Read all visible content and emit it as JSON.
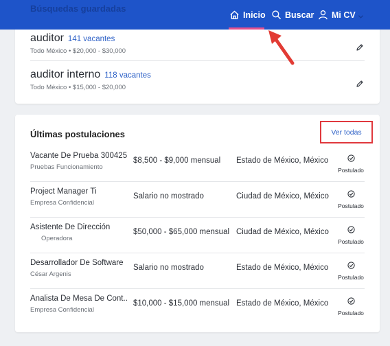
{
  "nav": {
    "background_title": "Búsquedas guardadas",
    "items": [
      {
        "label": "Inicio",
        "icon": "home-icon",
        "active": true
      },
      {
        "label": "Buscar",
        "icon": "search-icon"
      },
      {
        "label": "Mi CV",
        "icon": "user-icon"
      }
    ],
    "accent": "#e2508f",
    "bar_color": "#1e54c9"
  },
  "saved_searches": [
    {
      "query": "auditor",
      "count": "141 vacantes",
      "meta": "Todo México • $20,000 - $30,000"
    },
    {
      "query": "auditor interno",
      "count": "118 vacantes",
      "meta": "Todo México • $15,000 - $20,000"
    }
  ],
  "applications": {
    "title": "Últimas postulaciones",
    "see_all": "Ver todas",
    "rows": [
      {
        "title": "Vacante De Prueba 300425",
        "company": "Pruebas Funcionamiento",
        "salary": "$8,500 - $9,000 mensual",
        "location": "Estado de México, México",
        "status": "Postulado"
      },
      {
        "title": "Project Manager Ti",
        "company": "Empresa Confidencial",
        "salary": "Salario no mostrado",
        "location": "Ciudad de México, México",
        "status": "Postulado"
      },
      {
        "title": "Asistente De Dirección",
        "company": "Operadora",
        "salary": "$50,000 - $65,000 mensual",
        "location": "Ciudad de México, México",
        "status": "Postulado"
      },
      {
        "title": "Desarrollador De Software",
        "company": "César Argenis",
        "salary": "Salario no mostrado",
        "location": "Estado de México, México",
        "status": "Postulado"
      },
      {
        "title": "Analista De Mesa De Cont...",
        "company": "Empresa Confidencial",
        "salary": "$10,000 - $15,000 mensual",
        "location": "Estado de México, México",
        "status": "Postulado"
      }
    ]
  }
}
